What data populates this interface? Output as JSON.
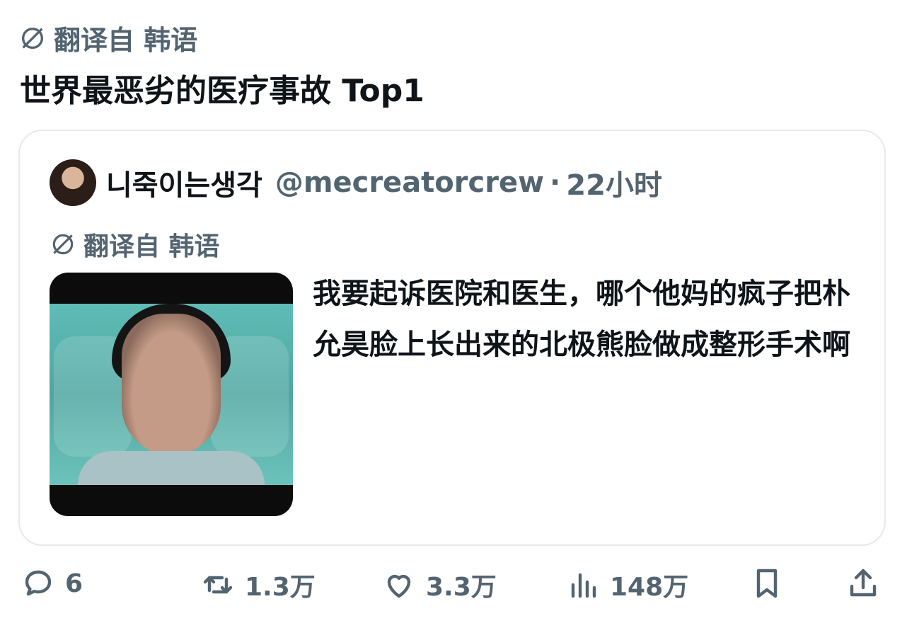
{
  "header": {
    "translate_label": "翻译自 韩语",
    "post_text": "世界最恶劣的医疗事故 Top1"
  },
  "quote": {
    "display_name": "니죽이는생각",
    "handle": "@mecreatorcrew",
    "separator": "·",
    "time": "22小时",
    "translate_label": "翻译自 韩语",
    "body": "我要起诉医院和医生，哪个他妈的疯子把朴允昊脸上长出来的北极熊脸做成整形手术啊"
  },
  "actions": {
    "reply_count": "6",
    "repost_count": "1.3万",
    "like_count": "3.3万",
    "view_count": "148万"
  },
  "icons": {
    "translate": "translate-icon",
    "reply": "reply-icon",
    "repost": "repost-icon",
    "like": "heart-icon",
    "views": "views-icon",
    "bookmark": "bookmark-icon",
    "share": "share-icon"
  },
  "colors": {
    "text_primary": "#0f1419",
    "text_secondary": "#536471",
    "card_border": "#e6e9ec"
  }
}
